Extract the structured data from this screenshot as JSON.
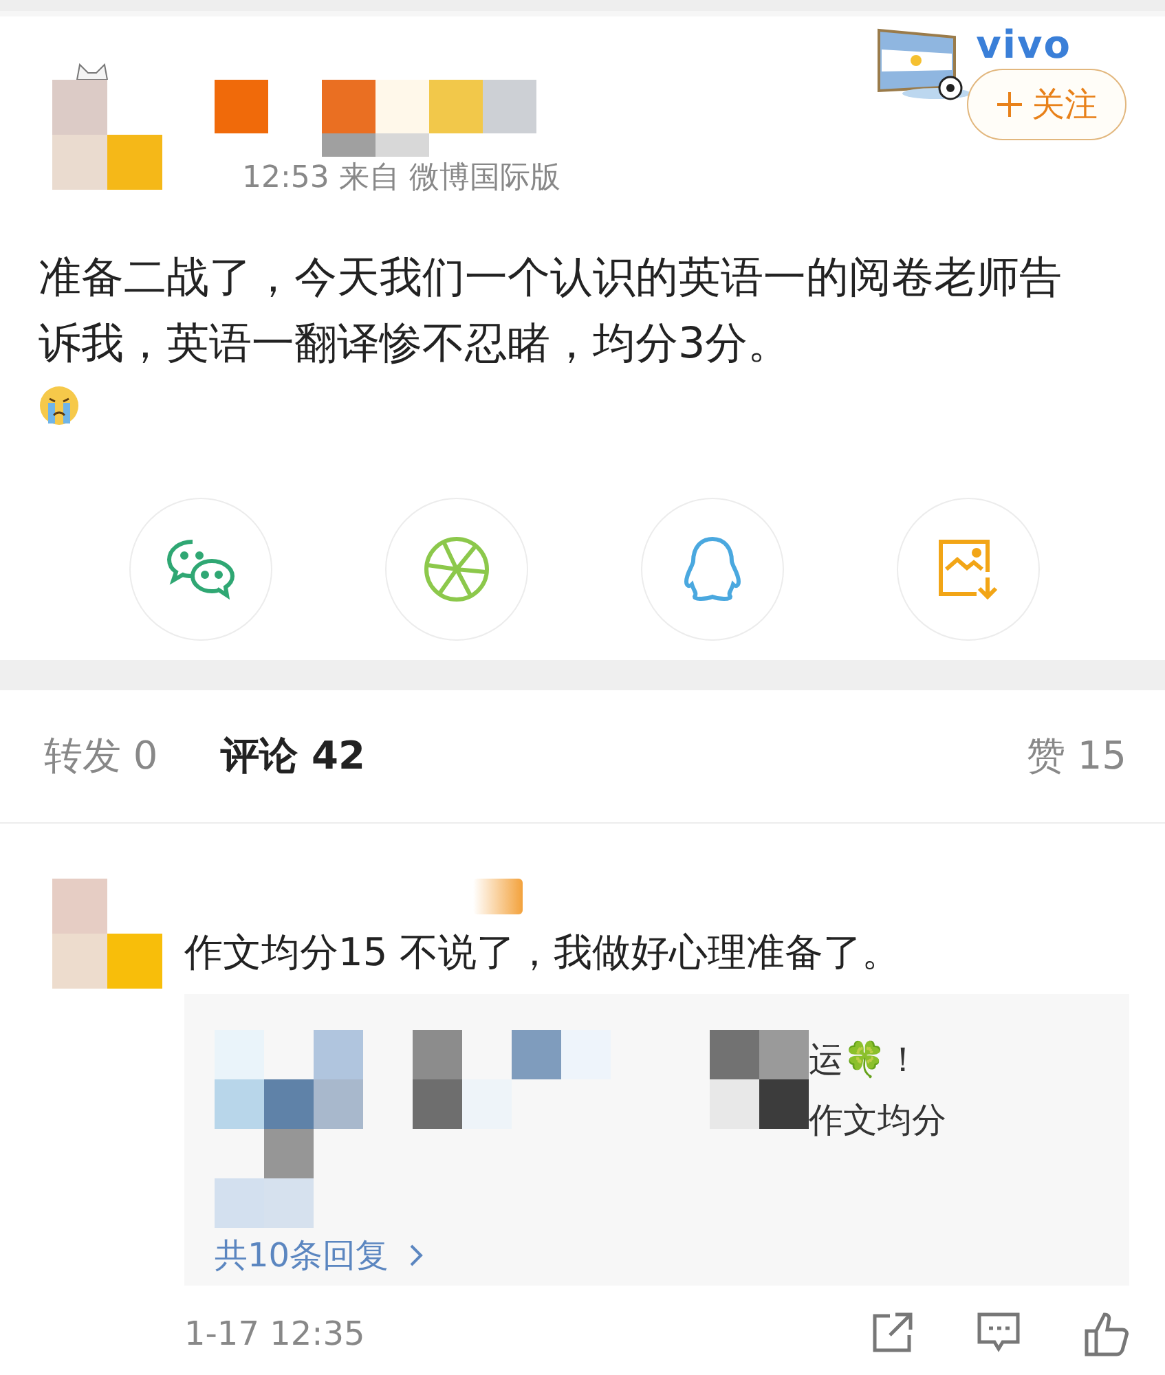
{
  "post": {
    "time_source": "12:53 来自 微博国际版",
    "badge": {
      "text": "vivo"
    },
    "follow_button": {
      "label": "关注"
    },
    "text": "准备二战了，今天我们一个认识的英语一的阅卷老师告诉我，英语一翻译惨不忍睹，均分3分。",
    "share_buttons": [
      {
        "kind": "wechat"
      },
      {
        "kind": "moments"
      },
      {
        "kind": "qq"
      },
      {
        "kind": "save-image"
      }
    ]
  },
  "tabs": [
    {
      "label": "转发",
      "count": "0",
      "selected": false
    },
    {
      "label": "评论",
      "count": "42",
      "selected": true
    },
    {
      "label": "赞",
      "count": "15",
      "selected": false
    }
  ],
  "comment": {
    "text": "作文均分15 不说了，我做好心理准备了。",
    "replies": [
      "运🍀！",
      "作文均分"
    ],
    "more_replies": "共10条回复",
    "time": "1-17 12:35"
  }
}
